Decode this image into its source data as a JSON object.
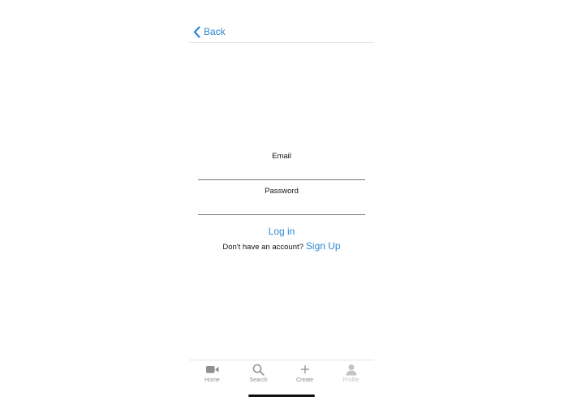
{
  "nav": {
    "back_label": "Back"
  },
  "form": {
    "email_label": "Email",
    "email_value": "",
    "password_label": "Password",
    "password_value": "",
    "login_label": "Log in",
    "signup_prompt": "Don't have an account?",
    "signup_label": "Sign Up"
  },
  "tabbar": {
    "items": [
      {
        "label": "Home",
        "icon": "video-camera-icon"
      },
      {
        "label": "Search",
        "icon": "search-icon"
      },
      {
        "label": "Create",
        "icon": "plus-icon"
      },
      {
        "label": "Profile",
        "icon": "person-icon"
      }
    ]
  },
  "colors": {
    "accent": "#2f86d6",
    "tab_icon": "#8e8e93",
    "tab_disabled": "#c4c4c8"
  }
}
